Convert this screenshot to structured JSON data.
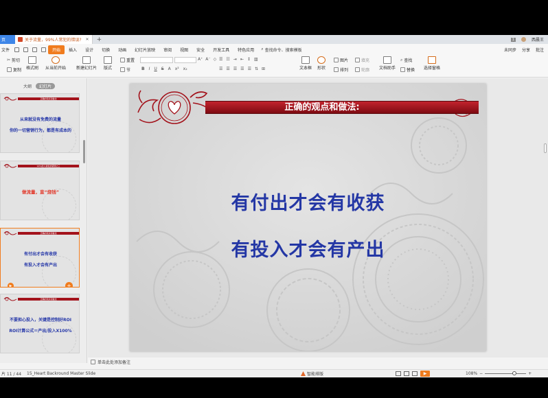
{
  "titlebar": {
    "home_tab": "页",
    "doc_tab": "关于流量，99%人常犯的错误?",
    "close_glyph": "✕",
    "new_tab_glyph": "+",
    "page_badge": "1",
    "user_name": "西晨王"
  },
  "menubar": {
    "file": "文件",
    "items": [
      "开始",
      "插入",
      "设计",
      "切换",
      "动画",
      "幻灯片放映",
      "审阅",
      "视图",
      "安全",
      "开发工具",
      "特色应用"
    ],
    "active_index": 0,
    "search": "查找命令、搜索模板",
    "right_actions": [
      "未同步",
      "分享",
      "批注"
    ]
  },
  "ribbon": {
    "cut": "剪切",
    "copy": "复制",
    "format_painter": "格式刷",
    "play_from_current": "从当前开始",
    "new_slide": "新建幻灯片",
    "layout": "版式",
    "reset": "重置",
    "section": "节",
    "text_box": "文本框",
    "shape": "形状",
    "picture": "图片",
    "arrange": "排列",
    "fill": "填充",
    "outline": "轮廓",
    "doc_helper": "文档助手",
    "find": "查找",
    "replace": "替换",
    "select_pane": "选择窗格"
  },
  "left_panel": {
    "tab_outline": "大纲",
    "tab_slides": "幻灯片",
    "thumbnails": [
      {
        "banner": "正确的观点和做法",
        "lines": [
          "从来就没有免费的流量",
          "你的一切营销行为，都是有成本的"
        ],
        "red": false
      },
      {
        "banner": "99%的人常犯的错误之三",
        "lines": [
          "做流量，直“烧钱”"
        ],
        "red": true
      },
      {
        "banner": "正确的观点和做法",
        "lines": [
          "有付出才会有收获",
          "有投入才会有产出"
        ],
        "red": false
      },
      {
        "banner": "正确的观点和做法",
        "lines": [
          "不要担心投入，关键是控制好ROI",
          "ROI计算公式＝产出/投入X100%"
        ],
        "red": false
      }
    ],
    "add_glyph": "+"
  },
  "slide": {
    "title": "正确的观点和做法:",
    "line1": "有付出才会有收获",
    "line2": "有投入才会有产出"
  },
  "notes": {
    "placeholder": "单击此处添加备注"
  },
  "statusbar": {
    "slide_count": "片 11 / 44",
    "theme": "15_Heart Backround Master Slide",
    "smart_layout": "智能排版",
    "zoom": "108%",
    "zoom_minus": "−",
    "zoom_plus": "+"
  },
  "colors": {
    "accent": "#f07c1e",
    "slide_text": "#2437a5",
    "title_bar": "#a3121b"
  }
}
